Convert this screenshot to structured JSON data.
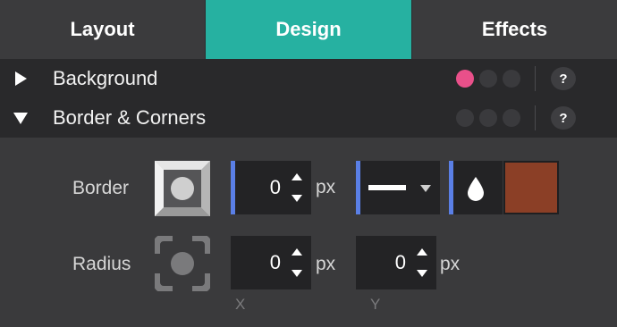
{
  "tabs": [
    {
      "label": "Layout",
      "active": false
    },
    {
      "label": "Design",
      "active": true
    },
    {
      "label": "Effects",
      "active": false
    }
  ],
  "colors": {
    "active_tab": "#26b1a1",
    "field_accent": "#5a7fe6",
    "background_indicator": "#e9508a",
    "border_color": "#8b3f26"
  },
  "sections": {
    "background": {
      "title": "Background",
      "expanded": false,
      "help": "?"
    },
    "border_corners": {
      "title": "Border & Corners",
      "expanded": true,
      "help": "?"
    }
  },
  "border": {
    "label": "Border",
    "width_value": "0",
    "unit": "px",
    "style_icon": "solid-line-icon",
    "color_icon": "droplet-icon",
    "color_hex": "#8b3f26"
  },
  "radius": {
    "label": "Radius",
    "x_value": "0",
    "y_value": "0",
    "unit": "px",
    "x_label": "X",
    "y_label": "Y"
  }
}
